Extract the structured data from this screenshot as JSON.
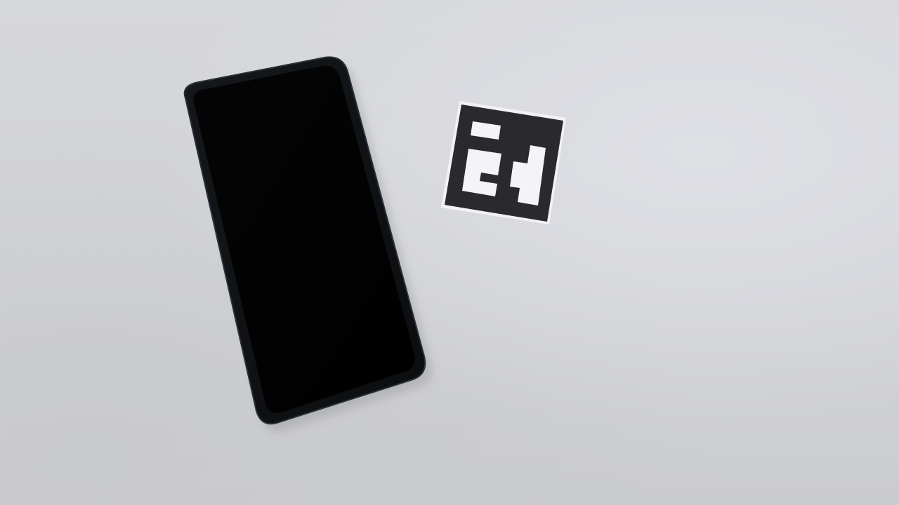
{
  "scene": {
    "background_color": "#d4d5d9",
    "objects": [
      {
        "name": "smartphone",
        "description_color": "#0a0b0c",
        "screen_state": "off"
      },
      {
        "name": "aruco-marker",
        "border_color": "#2a2a2c",
        "paper_color": "#f2f2f4"
      }
    ]
  }
}
